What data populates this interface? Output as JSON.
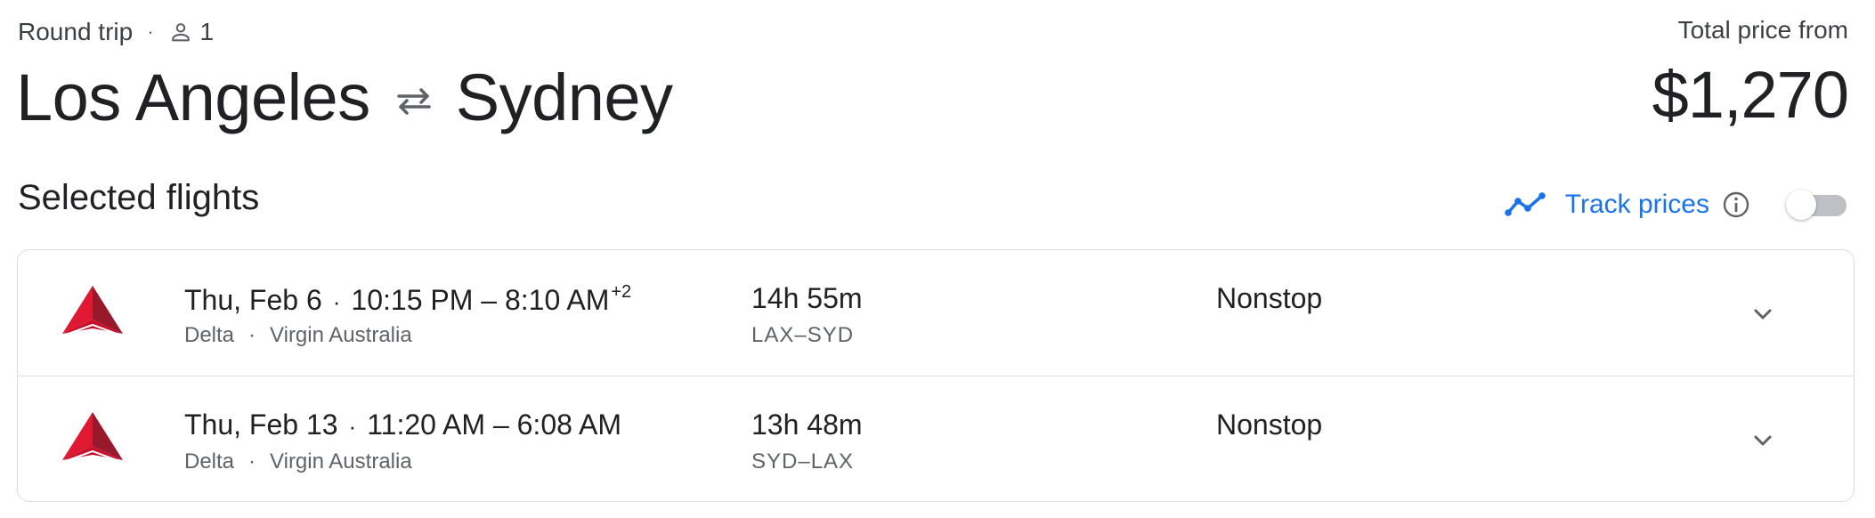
{
  "header": {
    "trip_type": "Round trip",
    "separator": "·",
    "passengers": "1",
    "origin": "Los Angeles",
    "destination": "Sydney",
    "price_label": "Total price from",
    "price": "$1,270"
  },
  "section": {
    "title": "Selected flights",
    "track_prices_label": "Track prices",
    "track_prices_enabled": false
  },
  "flights": [
    {
      "date": "Thu, Feb 6",
      "time_range": "10:15 PM – 8:10 AM",
      "day_offset": "+2",
      "airline_1": "Delta",
      "airline_2": "Virgin Australia",
      "duration": "14h 55m",
      "airports": "LAX–SYD",
      "stops": "Nonstop"
    },
    {
      "date": "Thu, Feb 13",
      "time_range": "11:20 AM – 6:08 AM",
      "day_offset": "",
      "airline_1": "Delta",
      "airline_2": "Virgin Australia",
      "duration": "13h 48m",
      "airports": "SYD–LAX",
      "stops": "Nonstop"
    }
  ],
  "icons": {
    "person": "person-icon",
    "swap": "swap-arrows-icon",
    "trend": "trend-line-icon",
    "info": "info-icon",
    "expand": "chevron-down-icon",
    "airline_logo": "delta-logo-icon"
  },
  "colors": {
    "accent": "#1a73e8",
    "text_primary": "#202124",
    "text_secondary": "#5f6368",
    "border": "#dadce0",
    "delta_red": "#e01933"
  }
}
